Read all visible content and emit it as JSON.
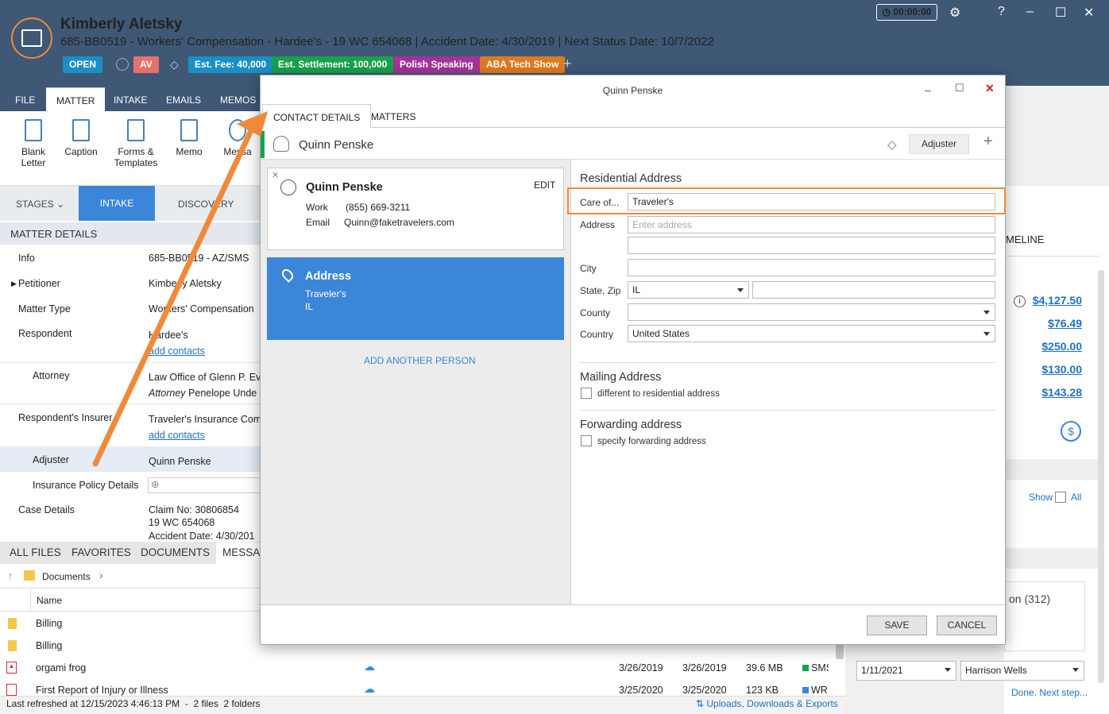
{
  "header": {
    "name": "Kimberly Aletsky",
    "subtitle": "685-BB0519 - Workers' Compensation - Hardee's - 19 WC 654068 | Accident Date: 4/30/2019 | Next Status Date: 10/7/2022",
    "status": "OPEN",
    "initials": "AV",
    "tags": [
      {
        "label": "Est. Fee: 40,000",
        "color": "#1a8fc7"
      },
      {
        "label": "Est. Settlement: 100,000",
        "color": "#17a24b"
      },
      {
        "label": "Polish Speaking",
        "color": "#a3339a"
      },
      {
        "label": "ABA Tech Show",
        "color": "#e07a1f"
      }
    ],
    "add_tag": "+",
    "timer": "00:00:00"
  },
  "menu": {
    "tabs": [
      "FILE",
      "MATTER",
      "INTAKE",
      "EMAILS",
      "MEMOS"
    ]
  },
  "ribbon": {
    "buttons": [
      "Blank Letter",
      "Caption",
      "Forms & Templates",
      "Memo",
      "Messa"
    ]
  },
  "stages": {
    "label": "STAGES",
    "current": "INTAKE",
    "next": "DISCOVERY"
  },
  "matter": {
    "title": "MATTER DETAILS",
    "rows": [
      {
        "label": "Info",
        "value": "685-BB0519 - AZ/SMS"
      },
      {
        "label": "Petitioner",
        "value": "Kimberly Aletsky"
      },
      {
        "label": "Matter Type",
        "value": "Workers' Compensation"
      },
      {
        "label": "Respondent",
        "value": "Hardee's",
        "link": "add contacts"
      },
      {
        "label": "Attorney",
        "value": "Law Office of Glenn P. Ev",
        "value2_italic": "Attorney",
        "value2": "Penelope Unde"
      },
      {
        "label": "Respondent's Insurer",
        "value": "Traveler's Insurance Com",
        "link": "add contacts"
      },
      {
        "label": "Adjuster",
        "value": "Quinn Penske"
      },
      {
        "label": "Insurance Policy Details",
        "value": ""
      },
      {
        "label": "Case Details",
        "value": "Claim No: 30806854",
        "value2": "19 WC 654068",
        "value3": "Accident Date: 4/30/201"
      }
    ]
  },
  "filetabs": [
    "ALL FILES",
    "FAVORITES",
    "DOCUMENTS",
    "MESSA"
  ],
  "files": {
    "breadcrumb": "Documents",
    "col_name": "Name",
    "rows": [
      {
        "name": "Billing",
        "type": "folder"
      },
      {
        "name": "Billing",
        "type": "folder"
      },
      {
        "name": "orgami frog",
        "type": "pdf",
        "d1": "3/26/2019",
        "d2": "3/26/2019",
        "size": "39.6 MB",
        "tag": "SMS"
      },
      {
        "name": "First Report of Injury or Illness",
        "type": "pdf",
        "d1": "3/25/2020",
        "d2": "3/25/2020",
        "size": "123 KB",
        "tag": "WR"
      }
    ]
  },
  "status": {
    "text": "Last refreshed at 12/15/2023 4:46:13 PM  -  2 files  2 folders",
    "link": "Uploads, Downloads & Exports"
  },
  "right": {
    "timeline": "MELINE",
    "amounts": [
      "$4,127.50",
      "$76.49",
      "$250.00",
      "$130.00",
      "$143.28"
    ],
    "show": "Show",
    "all": "All",
    "count": "on (312)",
    "date": "1/11/2021",
    "person": "Harrison Wells",
    "next": "Done. Next step..."
  },
  "modal": {
    "title": "Quinn Penske",
    "tabs": [
      "CONTACT DETAILS",
      "MATTERS"
    ],
    "contact_name": "Quinn Penske",
    "role": "Adjuster",
    "card": {
      "name": "Quinn Penske",
      "edit": "EDIT",
      "work_label": "Work",
      "work": "(855) 669-3211",
      "email_label": "Email",
      "email": "Quinn@faketravelers.com"
    },
    "address_card": {
      "title": "Address",
      "line1": "Traveler's",
      "line2": "IL"
    },
    "add_person": "ADD ANOTHER PERSON",
    "residential": {
      "title": "Residential Address",
      "care_label": "Care of...",
      "care_value": "Traveler's",
      "address_label": "Address",
      "address_placeholder": "Enter address",
      "city_label": "City",
      "statezip_label": "State, Zip",
      "state": "IL",
      "county_label": "County",
      "country_label": "Country",
      "country": "United States"
    },
    "mailing": {
      "title": "Mailing Address",
      "checkbox": "different to residential address"
    },
    "forwarding": {
      "title": "Forwarding address",
      "checkbox": "specify forwarding address"
    },
    "save": "SAVE",
    "cancel": "CANCEL"
  }
}
